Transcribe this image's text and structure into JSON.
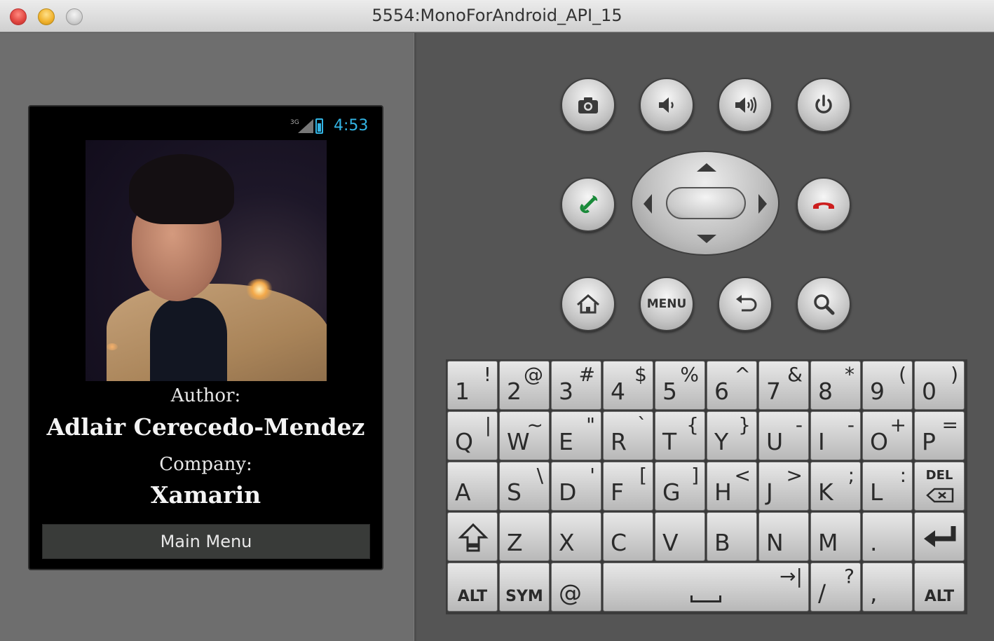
{
  "window": {
    "title": "5554:MonoForAndroid_API_15"
  },
  "phone": {
    "status": {
      "signal": "3G",
      "time": "4:53"
    },
    "author_label": "Author:",
    "author_name": "Adlair Cerecedo-Mendez",
    "company_label": "Company:",
    "company_name": "Xamarin",
    "main_menu_button": "Main Menu"
  },
  "controls": {
    "menu_label": "MENU",
    "icons": [
      "camera-icon",
      "volume-down-icon",
      "volume-up-icon",
      "power-icon",
      "call-icon",
      "end-call-icon",
      "home-icon",
      "back-icon",
      "search-icon"
    ]
  },
  "keyboard": {
    "row1": [
      {
        "main": "1",
        "alt": "!"
      },
      {
        "main": "2",
        "alt": "@"
      },
      {
        "main": "3",
        "alt": "#"
      },
      {
        "main": "4",
        "alt": "$"
      },
      {
        "main": "5",
        "alt": "%"
      },
      {
        "main": "6",
        "alt": "^"
      },
      {
        "main": "7",
        "alt": "&"
      },
      {
        "main": "8",
        "alt": "*"
      },
      {
        "main": "9",
        "alt": "("
      },
      {
        "main": "0",
        "alt": ")"
      }
    ],
    "row2": [
      {
        "main": "Q",
        "alt": "|"
      },
      {
        "main": "W",
        "alt": "~"
      },
      {
        "main": "E",
        "alt": "\""
      },
      {
        "main": "R",
        "alt": "`"
      },
      {
        "main": "T",
        "alt": "{"
      },
      {
        "main": "Y",
        "alt": "}"
      },
      {
        "main": "U",
        "alt": "-"
      },
      {
        "main": "I",
        "alt": "-"
      },
      {
        "main": "O",
        "alt": "+"
      },
      {
        "main": "P",
        "alt": "="
      }
    ],
    "row3": [
      {
        "main": "A",
        "alt": ""
      },
      {
        "main": "S",
        "alt": "\\"
      },
      {
        "main": "D",
        "alt": "'"
      },
      {
        "main": "F",
        "alt": "["
      },
      {
        "main": "G",
        "alt": "]"
      },
      {
        "main": "H",
        "alt": "<"
      },
      {
        "main": "J",
        "alt": ">"
      },
      {
        "main": "K",
        "alt": ";"
      },
      {
        "main": "L",
        "alt": ":"
      }
    ],
    "del_label": "DEL",
    "row4": [
      {
        "main": "Z"
      },
      {
        "main": "X"
      },
      {
        "main": "C"
      },
      {
        "main": "V"
      },
      {
        "main": "B"
      },
      {
        "main": "N"
      },
      {
        "main": "M"
      },
      {
        "main": "."
      }
    ],
    "alt_label": "ALT",
    "sym_label": "SYM",
    "at_label": "@",
    "tab_label": "→|",
    "slash_main": "/",
    "slash_alt": "?",
    "comma_main": ","
  }
}
